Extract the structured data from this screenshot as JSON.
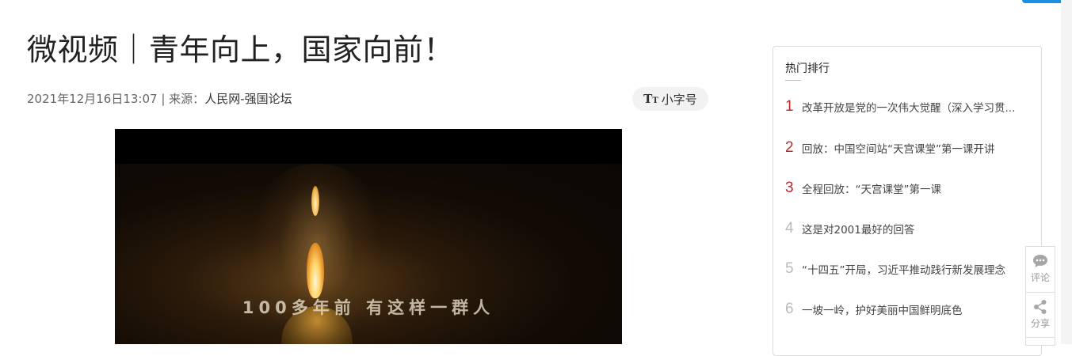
{
  "article": {
    "title": "微视频｜青年向上，国家向前！",
    "datetime": "2021年12月16日13:07",
    "separator": " | ",
    "source_prefix": "来源：",
    "source": "人民网-强国论坛",
    "font_toggle": {
      "icon_text": "T",
      "icon_small": "T",
      "label": "小字号"
    },
    "video": {
      "subtitle": "100多年前 有这样一群人"
    }
  },
  "sidebar": {
    "heading": "热门排行",
    "items": [
      {
        "rank": "1",
        "text": "改革开放是党的一次伟大觉醒（深入学习贯...",
        "color": "#c0282d"
      },
      {
        "rank": "2",
        "text": "回放：中国空间站“天宫课堂”第一课开讲",
        "color": "#c0282d"
      },
      {
        "rank": "3",
        "text": "全程回放：“天宫课堂”第一课",
        "color": "#c0282d"
      },
      {
        "rank": "4",
        "text": "这是对2001最好的回答",
        "color": "#bbbbbb"
      },
      {
        "rank": "5",
        "text": "“十四五”开局，习近平推动践行新发展理念",
        "color": "#bbbbbb"
      },
      {
        "rank": "6",
        "text": "一坡一岭，护好美丽中国鲜明底色",
        "color": "#bbbbbb"
      }
    ]
  },
  "float_bar": {
    "comment_label": "评论",
    "comment_icon": "comment-icon",
    "share_label": "分享",
    "share_icon": "share-icon"
  },
  "colors": {
    "accent_blue": "#1e8fe0",
    "rank_top": "#c0282d",
    "rank_rest": "#bbbbbb"
  }
}
